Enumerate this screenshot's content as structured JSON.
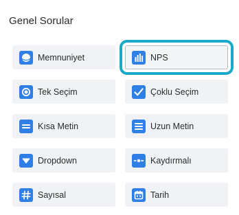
{
  "section": {
    "title": "Genel Sorular"
  },
  "question_types": [
    {
      "label": "Memnuniyet",
      "icon": "smiley-icon",
      "selected": false
    },
    {
      "label": "NPS",
      "icon": "bar-chart-icon",
      "selected": true
    },
    {
      "label": "Tek Seçim",
      "icon": "radio-icon",
      "selected": false
    },
    {
      "label": "Çoklu Seçim",
      "icon": "checkmark-icon",
      "selected": false
    },
    {
      "label": "Kısa Metin",
      "icon": "short-text-icon",
      "selected": false
    },
    {
      "label": "Uzun Metin",
      "icon": "long-text-icon",
      "selected": false
    },
    {
      "label": "Dropdown",
      "icon": "dropdown-arrow-icon",
      "selected": false
    },
    {
      "label": "Kaydırmalı",
      "icon": "slider-icon",
      "selected": false
    },
    {
      "label": "Sayısal",
      "icon": "hash-icon",
      "selected": false
    },
    {
      "label": "Tarih",
      "icon": "calendar-icon",
      "selected": false
    }
  ],
  "colors": {
    "icon_background": "#2f7fe6",
    "selection_outline": "#1aa9c9",
    "tile_background": "#f1f2f5"
  }
}
